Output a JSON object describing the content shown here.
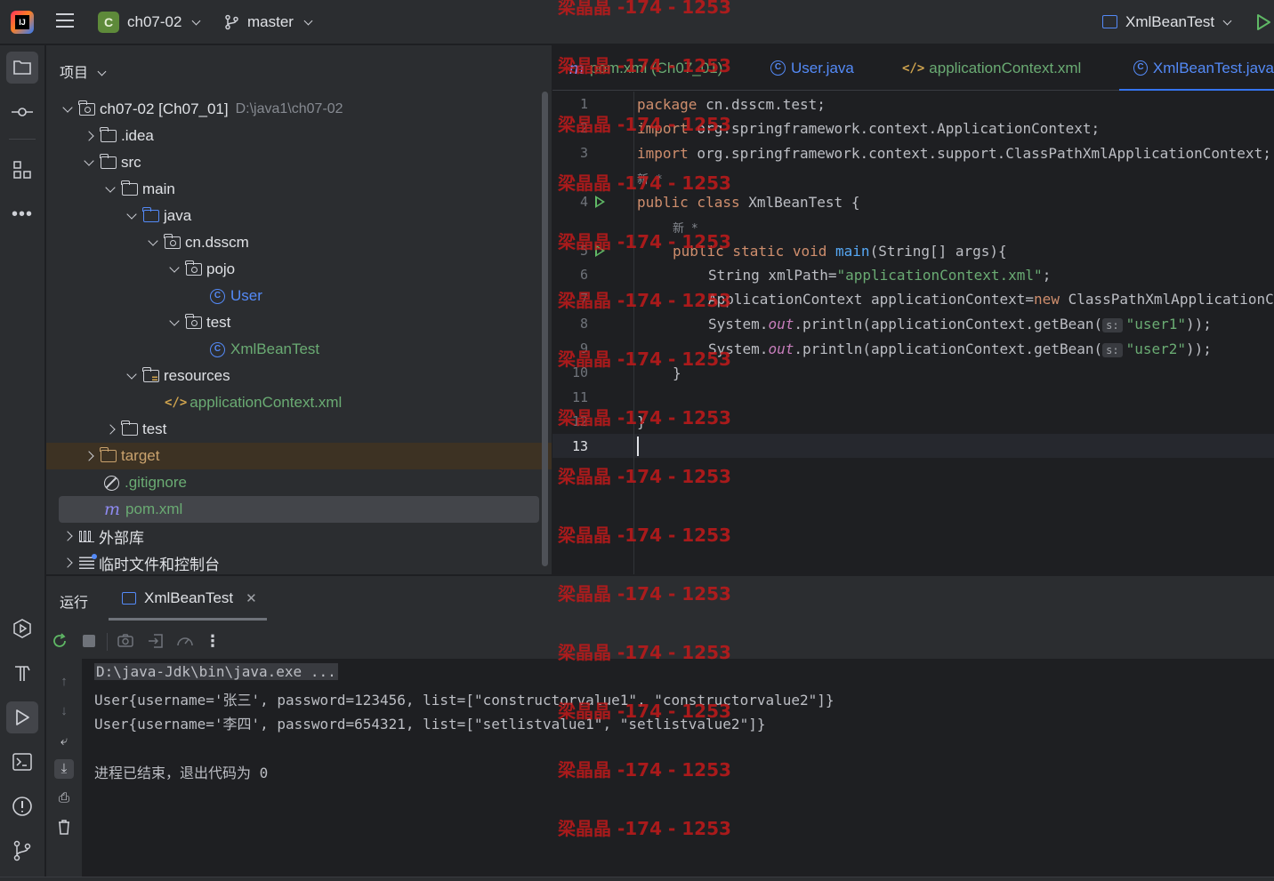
{
  "titlebar": {
    "project_badge": "C",
    "project_name": "ch07-02",
    "branch": "master",
    "run_config": "XmlBeanTest"
  },
  "project_panel": {
    "header": "项目",
    "rows": [
      {
        "label": "ch07-02 [Ch07_01]",
        "path": "D:\\java1\\ch07-02"
      },
      {
        "label": ".idea"
      },
      {
        "label": "src"
      },
      {
        "label": "main"
      },
      {
        "label": "java"
      },
      {
        "label": "cn.dsscm"
      },
      {
        "label": "pojo"
      },
      {
        "label": "User"
      },
      {
        "label": "test"
      },
      {
        "label": "XmlBeanTest"
      },
      {
        "label": "resources"
      },
      {
        "label": "applicationContext.xml"
      },
      {
        "label": "test"
      },
      {
        "label": "target"
      },
      {
        "label": ".gitignore"
      },
      {
        "label": "pom.xml"
      },
      {
        "label": "外部库"
      },
      {
        "label": "临时文件和控制台"
      }
    ]
  },
  "editor_tabs": [
    {
      "label": "pom.xml (Ch07_01)"
    },
    {
      "label": "User.java"
    },
    {
      "label": "applicationContext.xml"
    },
    {
      "label": "XmlBeanTest.java"
    }
  ],
  "editor": {
    "line_numbers": [
      "1",
      "2",
      "3",
      "4",
      "5",
      "6",
      "7",
      "8",
      "9",
      "10",
      "11",
      "12",
      "13"
    ],
    "inlay_new_1": "新 *",
    "inlay_new_2": "新 *",
    "hint_s": "s:",
    "code": {
      "l1_kw": "package",
      "l1_rest": " cn.dsscm.test;",
      "l2_kw": "import",
      "l2_rest": " org.springframework.context.ApplicationContext;",
      "l3_kw": "import",
      "l3_rest": " org.springframework.context.support.ClassPathXmlApplicationContext;",
      "l4_kw": "public class",
      "l4_rest": " XmlBeanTest {",
      "l5_kw": "public static void",
      "l5_fn": " main",
      "l5_rest": "(String[] args){",
      "l6_a": "String xmlPath=",
      "l6_str": "\"applicationContext.xml\"",
      "l6_b": ";",
      "l7_a": "ApplicationContext applicationContext=",
      "l7_kw": "new",
      "l7_b": " ClassPathXmlApplicationContext(xmlPath);",
      "l8_a": "System.",
      "l8_st": "out",
      "l8_b": ".println(applicationContext.getBean(",
      "l8_str": "\"user1\"",
      "l8_c": "));",
      "l9_a": "System.",
      "l9_st": "out",
      "l9_b": ".println(applicationContext.getBean(",
      "l9_str": "\"user2\"",
      "l9_c": "));",
      "l10": "}",
      "l12": "}"
    }
  },
  "run_panel": {
    "title": "运行",
    "tab_label": "XmlBeanTest",
    "console": [
      "D:\\java-Jdk\\bin\\java.exe ...",
      "User{username='张三', password=123456, list=[\"constructorvalue1\", \"constructorvalue2\"]}",
      "User{username='李四', password=654321, list=[\"setlistvalue1\", \"setlistvalue2\"]}",
      "进程已结束，退出代码为 0"
    ]
  },
  "watermark": "梁晶晶 -174 - 1253"
}
